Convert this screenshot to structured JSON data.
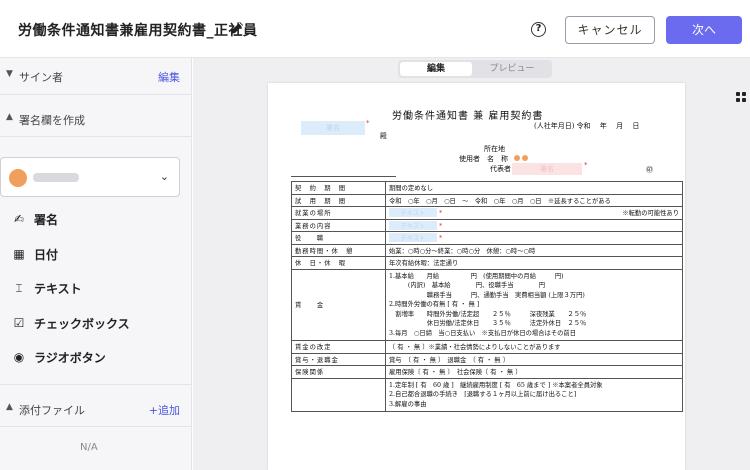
{
  "header": {
    "title": "労働条件通知書兼雇用契約書_正社員",
    "help_glyph": "?",
    "cancel_label": "キャンセル",
    "next_label": "次へ"
  },
  "sidebar": {
    "signers": {
      "label": "サイン者",
      "action": "編集"
    },
    "create_signature": {
      "label": "署名欄を作成"
    },
    "fields": [
      {
        "icon": "signature-icon",
        "label": "署名"
      },
      {
        "icon": "calendar-icon",
        "label": "日付"
      },
      {
        "icon": "text-icon",
        "label": "テキスト"
      },
      {
        "icon": "checkbox-icon",
        "label": "チェックボックス"
      },
      {
        "icon": "radio-icon",
        "label": "ラジオボタン"
      }
    ],
    "attachments": {
      "label": "添付ファイル",
      "action": "+追加",
      "empty": "N/A"
    }
  },
  "view_toggle": {
    "edit": "編集",
    "preview": "プレビュー"
  },
  "document": {
    "heading": "労働条件通知書 兼 雇用契約書",
    "date_line": "(人社年月日) 令和　 年　 月　 日",
    "name_placeholder": "署名",
    "dono": "殿",
    "address_label": "所在地",
    "company_label": "使用者　名　称",
    "rep_label": "代表者",
    "rep_placeholder": "署名",
    "seal": "㊞",
    "rows": [
      {
        "head": "契　約　期　間",
        "body": "期間の定めなし"
      },
      {
        "head": "試　用　期　間",
        "body": "令和　○年　○月　○日　〜　令和　○年　○月　○日　※延長することがある"
      },
      {
        "head": "就業の場所",
        "body": "テキスト",
        "note": "※転勤の可能性あり"
      },
      {
        "head": "業務の内容",
        "body": "テキスト"
      },
      {
        "head": "役　　職",
        "body": "テキスト"
      },
      {
        "head": "勤務時間・休　憩",
        "body": "始業：○時○分〜終業：○時○分　休憩：○時〜○時"
      },
      {
        "head": "休　日・休　暇",
        "body": "年次有給休暇：法定通り"
      }
    ],
    "wage_head": "賃　　金",
    "wage_lines": [
      "1.基本給　　月給　　　　　円　(使用期間中の月給　　　円)",
      "　　　(内訳)　基本給　　　　円、役職手当　　　　円",
      "　　　　　　職務手当　　　円、通勤手当　実費相当額 (上限３万円)",
      "2.時間外労働の有無 [ 有 ・ 無 ]",
      "　割増率　　時間外労働/法定超　　２５％　　　深夜残業　　２５％",
      "　　　　　　休日労働/法定休日　　３５％　　　法定外休日　２５％",
      "3.毎月　○日締　当○日支払い　※支払日が休日の場合はその前日"
    ],
    "raise": {
      "head": "賃金の改定",
      "body": "〔 有 ・ 無 〕※業績・社会情勢によりしないことがあります"
    },
    "bonus": {
      "head": "賞与・退職金",
      "body": "賞与　〔 有 ・ 無 〕　退職金　〔 有 ・ 無 〕"
    },
    "insurance": {
      "head": "保険関係",
      "body": "雇用保険〔 有 ・ 無 〕　社会保険〔 有 ・ 無 〕"
    },
    "retire_lines": [
      "1.定年制 [ 有　60 歳 ]　継続雇用制度 [ 有　65 歳まで ] ※本案者全員対象",
      "2.自己都合退職の手続き　[退職する１ヶ月以上前に届け出ること]",
      "3.解雇の事由"
    ]
  },
  "colors": {
    "accent": "#6b6bf0",
    "link": "#4a55e0",
    "placeholder_blue": "#dcecfa",
    "placeholder_pink": "#fbe3e3",
    "required": "#e0303a"
  }
}
